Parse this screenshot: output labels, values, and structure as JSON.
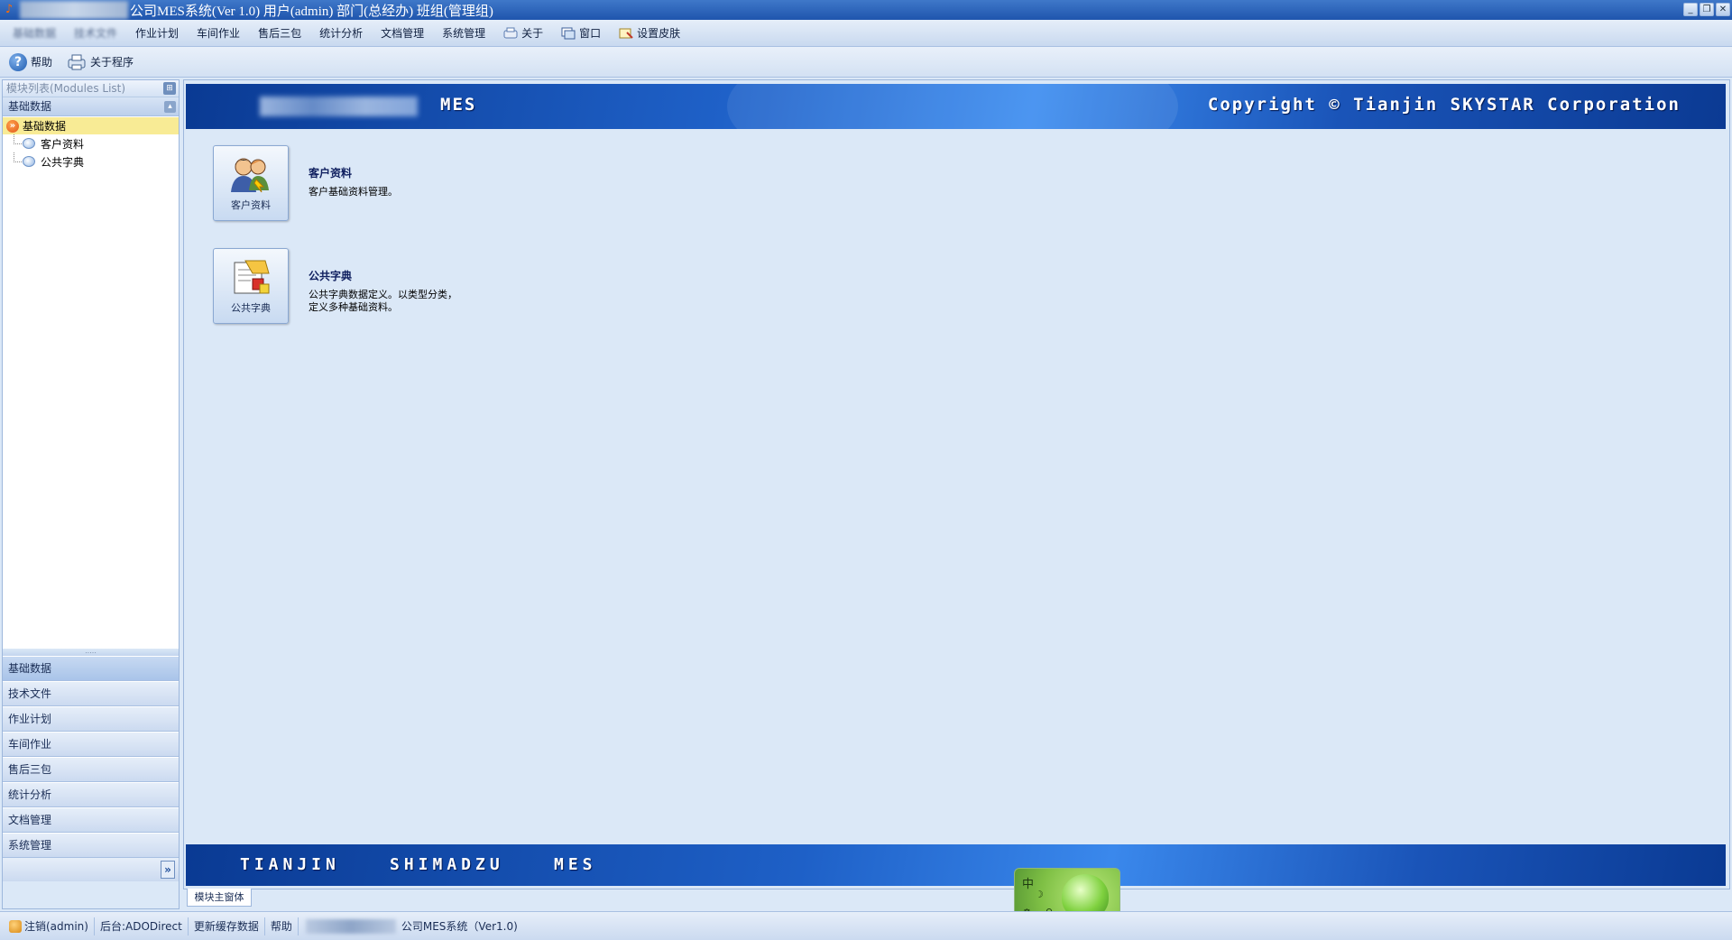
{
  "window": {
    "title": "公司MES系统(Ver 1.0)  用户(admin)  部门(总经办)  班组(管理组)",
    "controls": [
      "minimize",
      "restore",
      "close"
    ]
  },
  "menu": {
    "items": [
      {
        "label": "基础数据",
        "blurred": true
      },
      {
        "label": "技术文件",
        "blurred": true
      },
      {
        "label": "作业计划"
      },
      {
        "label": "车间作业"
      },
      {
        "label": "售后三包"
      },
      {
        "label": "统计分析"
      },
      {
        "label": "文档管理"
      },
      {
        "label": "系统管理"
      },
      {
        "label": "关于",
        "icon": "about-icon"
      },
      {
        "label": "窗口",
        "icon": "window-icon"
      },
      {
        "label": "设置皮肤",
        "icon": "skin-icon"
      }
    ]
  },
  "toolbar": {
    "help_label": "帮助",
    "about_label": "关于程序"
  },
  "left_panel": {
    "header": "模块列表(Modules List)",
    "group_title": "基础数据",
    "tree": {
      "root": "基础数据",
      "children": [
        "客户资料",
        "公共字典"
      ]
    },
    "nav": [
      "基础数据",
      "技术文件",
      "作业计划",
      "车间作业",
      "售后三包",
      "统计分析",
      "文档管理",
      "系统管理"
    ],
    "active_nav": 0
  },
  "banner": {
    "product": "MES",
    "copyright": "Copyright © Tianjin SKYSTAR Corporation",
    "bottom": [
      "TIANJIN",
      "SHIMADZU",
      "MES"
    ]
  },
  "modules": [
    {
      "button_label": "客户资料",
      "title": "客户资料",
      "desc_lines": [
        "客户基础资料管理。"
      ]
    },
    {
      "button_label": "公共字典",
      "title": "公共字典",
      "desc_lines": [
        "公共字典数据定义。以类型分类，",
        "定义多种基础资料。"
      ]
    }
  ],
  "doc_tab": "模块主窗体",
  "ime": {
    "label": "中"
  },
  "statusbar": {
    "logout": "注销(admin)",
    "backend": "后台:ADODirect",
    "refresh": "更新缓存数据",
    "help": "帮助",
    "system": "公司MES系统（Ver1.0)"
  }
}
